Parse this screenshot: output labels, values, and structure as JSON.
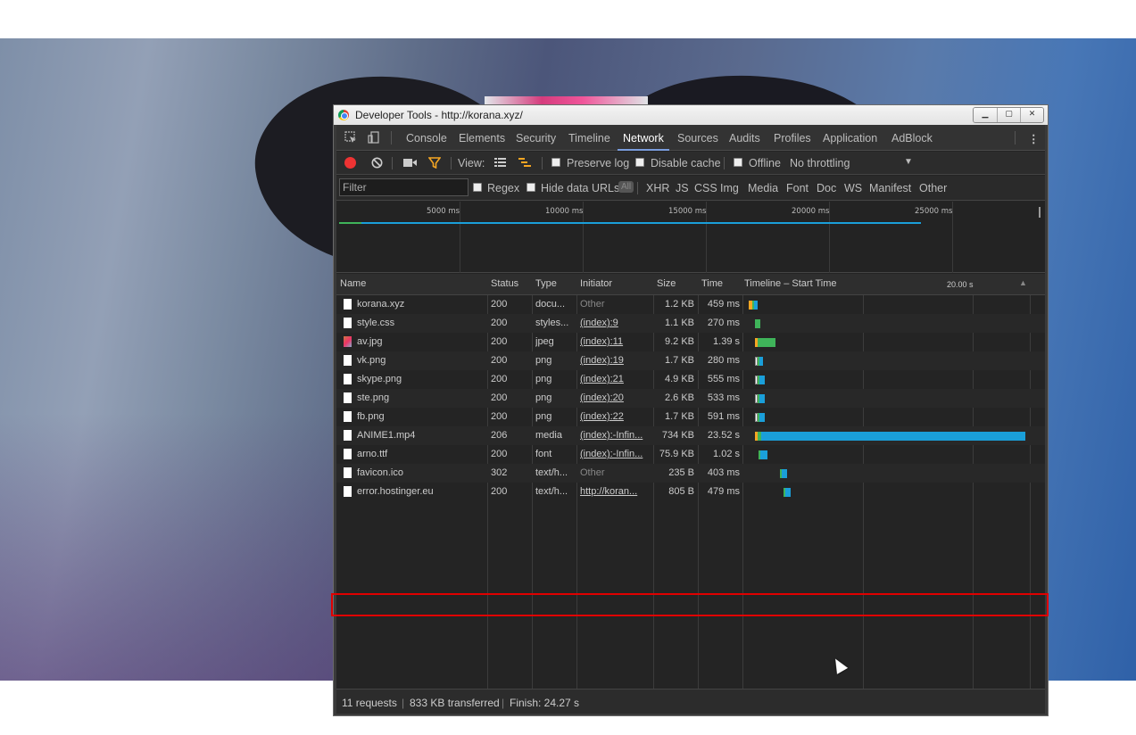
{
  "window": {
    "title": "Developer Tools - http://korana.xyz/",
    "buttons": [
      "minimize",
      "maximize",
      "close"
    ]
  },
  "tabs": [
    "Console",
    "Elements",
    "Security",
    "Timeline",
    "Network",
    "Sources",
    "Audits",
    "Profiles",
    "Application",
    "AdBlock"
  ],
  "active_tab": "Network",
  "toolbar": {
    "view_label": "View:",
    "preserve_log": "Preserve log",
    "disable_cache": "Disable cache",
    "offline": "Offline",
    "throttling": "No throttling"
  },
  "filter": {
    "placeholder": "Filter",
    "regex": "Regex",
    "hide_data_urls": "Hide data URLs",
    "all": "All",
    "types": [
      "XHR",
      "JS",
      "CSS",
      "Img",
      "Media",
      "Font",
      "Doc",
      "WS",
      "Manifest",
      "Other"
    ]
  },
  "overview": {
    "ticks": [
      "5000 ms",
      "10000 ms",
      "15000 ms",
      "20000 ms",
      "25000 ms"
    ]
  },
  "columns": {
    "name": "Name",
    "status": "Status",
    "type": "Type",
    "initiator": "Initiator",
    "size": "Size",
    "time": "Time",
    "timeline": "Timeline – Start Time",
    "timeline_tick": "20.00 s"
  },
  "requests": [
    {
      "name": "korana.xyz",
      "status": "200",
      "type": "docu...",
      "initiator": "Other",
      "size": "1.2 KB",
      "time": "459 ms"
    },
    {
      "name": "style.css",
      "status": "200",
      "type": "styles...",
      "initiator": "(index):9",
      "size": "1.1 KB",
      "time": "270 ms"
    },
    {
      "name": "av.jpg",
      "status": "200",
      "type": "jpeg",
      "initiator": "(index):11",
      "size": "9.2 KB",
      "time": "1.39 s"
    },
    {
      "name": "vk.png",
      "status": "200",
      "type": "png",
      "initiator": "(index):19",
      "size": "1.7 KB",
      "time": "280 ms"
    },
    {
      "name": "skype.png",
      "status": "200",
      "type": "png",
      "initiator": "(index):21",
      "size": "4.9 KB",
      "time": "555 ms"
    },
    {
      "name": "ste.png",
      "status": "200",
      "type": "png",
      "initiator": "(index):20",
      "size": "2.6 KB",
      "time": "533 ms"
    },
    {
      "name": "fb.png",
      "status": "200",
      "type": "png",
      "initiator": "(index):22",
      "size": "1.7 KB",
      "time": "591 ms"
    },
    {
      "name": "ANIME1.mp4",
      "status": "206",
      "type": "media",
      "initiator": "(index):-Infin...",
      "size": "734 KB",
      "time": "23.52 s"
    },
    {
      "name": "arno.ttf",
      "status": "200",
      "type": "font",
      "initiator": "(index):-Infin...",
      "size": "75.9 KB",
      "time": "1.02 s"
    },
    {
      "name": "favicon.ico",
      "status": "302",
      "type": "text/h...",
      "initiator": "Other",
      "size": "235 B",
      "time": "403 ms"
    },
    {
      "name": "error.hostinger.eu",
      "status": "200",
      "type": "text/h...",
      "initiator": "http://koran...",
      "size": "805 B",
      "time": "479 ms"
    }
  ],
  "statusbar": {
    "requests": "11 requests",
    "transferred": "833 KB transferred",
    "finish": "Finish: 24.27 s"
  },
  "colors": {
    "waiting": "#3fb45a",
    "download": "#1a9fd9",
    "queue": "#f5a623",
    "highlight": "#e00000"
  }
}
